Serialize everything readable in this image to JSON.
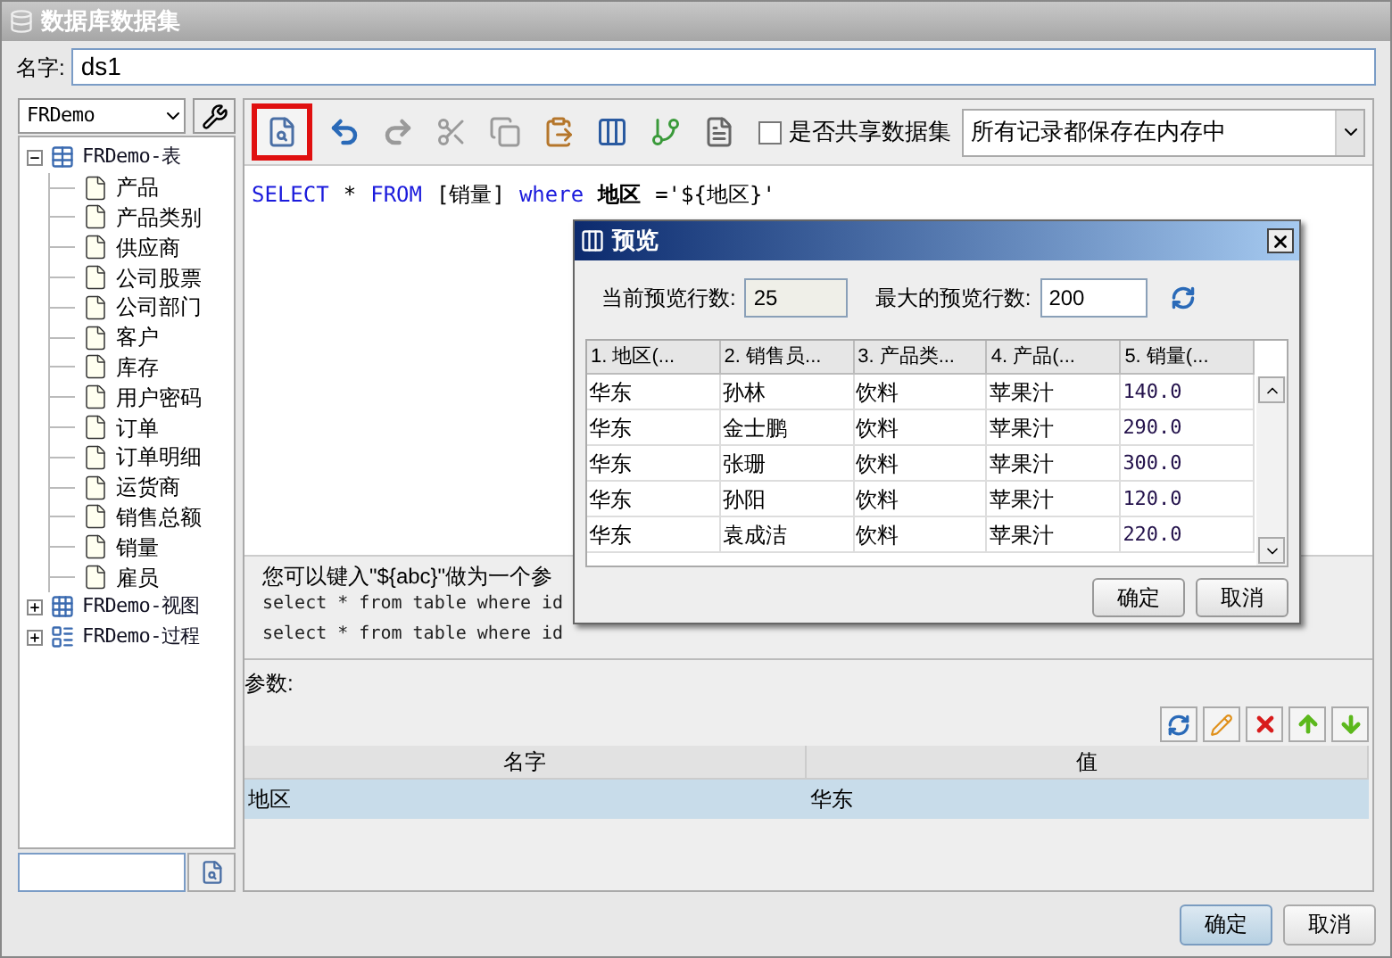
{
  "window": {
    "title": "数据库数据集"
  },
  "name_field": {
    "label": "名字:",
    "value": "ds1"
  },
  "datasource": {
    "value": "FRDemo"
  },
  "tree": [
    {
      "label": "FRDemo-表",
      "kind": "tables",
      "expanded": true,
      "children": [
        {
          "label": "产品"
        },
        {
          "label": "产品类别"
        },
        {
          "label": "供应商"
        },
        {
          "label": "公司股票"
        },
        {
          "label": "公司部门"
        },
        {
          "label": "客户"
        },
        {
          "label": "库存"
        },
        {
          "label": "用户密码"
        },
        {
          "label": "订单"
        },
        {
          "label": "订单明细"
        },
        {
          "label": "运货商"
        },
        {
          "label": "销售总额"
        },
        {
          "label": "销量"
        },
        {
          "label": "雇员"
        }
      ]
    },
    {
      "label": "FRDemo-视图",
      "kind": "views",
      "expanded": false
    },
    {
      "label": "FRDemo-过程",
      "kind": "procedures",
      "expanded": false
    }
  ],
  "toolbar": {
    "tools": [
      {
        "kind": "preview",
        "highlighted": true,
        "disabled": false
      },
      {
        "kind": "undo",
        "highlighted": false,
        "disabled": false
      },
      {
        "kind": "redo",
        "highlighted": false,
        "disabled": true
      },
      {
        "kind": "cut",
        "highlighted": false,
        "disabled": true
      },
      {
        "kind": "copy",
        "highlighted": false,
        "disabled": true
      },
      {
        "kind": "paste",
        "highlighted": false,
        "disabled": false
      },
      {
        "kind": "columns",
        "highlighted": false,
        "disabled": false
      },
      {
        "kind": "branch",
        "highlighted": false,
        "disabled": false
      },
      {
        "kind": "document",
        "highlighted": false,
        "disabled": false
      }
    ],
    "share": {
      "label": "是否共享数据集",
      "checked": false
    },
    "storage": {
      "value": "所有记录都保存在内存中"
    }
  },
  "sql": [
    {
      "kind": "keyword",
      "text": "SELECT"
    },
    {
      "kind": "plain",
      "text": "*"
    },
    {
      "kind": "keyword",
      "text": "FROM"
    },
    {
      "kind": "plain",
      "text": "[销量]"
    },
    {
      "kind": "keyword",
      "text": "where"
    },
    {
      "kind": "bold",
      "text": "地区"
    },
    {
      "kind": "plain",
      "text": "='${地区}'"
    }
  ],
  "hints": [
    {
      "kind": "text",
      "text": "您可以键入\"${abc}\"做为一个参"
    },
    {
      "kind": "code",
      "text": "select * from table where id"
    },
    {
      "kind": "code",
      "text": "select * from table where id"
    }
  ],
  "params": {
    "label": "参数:",
    "columns": [
      "名字",
      "值"
    ],
    "rows": [
      {
        "name": "地区",
        "value": "华东",
        "selected": true
      }
    ]
  },
  "buttons": [
    {
      "label": "确定",
      "focused": true
    },
    {
      "label": "取消",
      "focused": false
    }
  ],
  "preview": {
    "title": "预览",
    "current_rows": {
      "label": "当前预览行数:",
      "value": "25"
    },
    "max_rows": {
      "label": "最大的预览行数:",
      "value": "200"
    },
    "columns": [
      "1. 地区(...",
      "2. 销售员...",
      "3. 产品类...",
      "4. 产品(...",
      "5. 销量(..."
    ],
    "rows": [
      [
        "华东",
        "孙林",
        "饮料",
        "苹果汁",
        "140.0"
      ],
      [
        "华东",
        "金士鹏",
        "饮料",
        "苹果汁",
        "290.0"
      ],
      [
        "华东",
        "张珊",
        "饮料",
        "苹果汁",
        "300.0"
      ],
      [
        "华东",
        "孙阳",
        "饮料",
        "苹果汁",
        "120.0"
      ],
      [
        "华东",
        "袁成洁",
        "饮料",
        "苹果汁",
        "220.0"
      ]
    ],
    "buttons": [
      {
        "label": "确定"
      },
      {
        "label": "取消"
      }
    ]
  }
}
